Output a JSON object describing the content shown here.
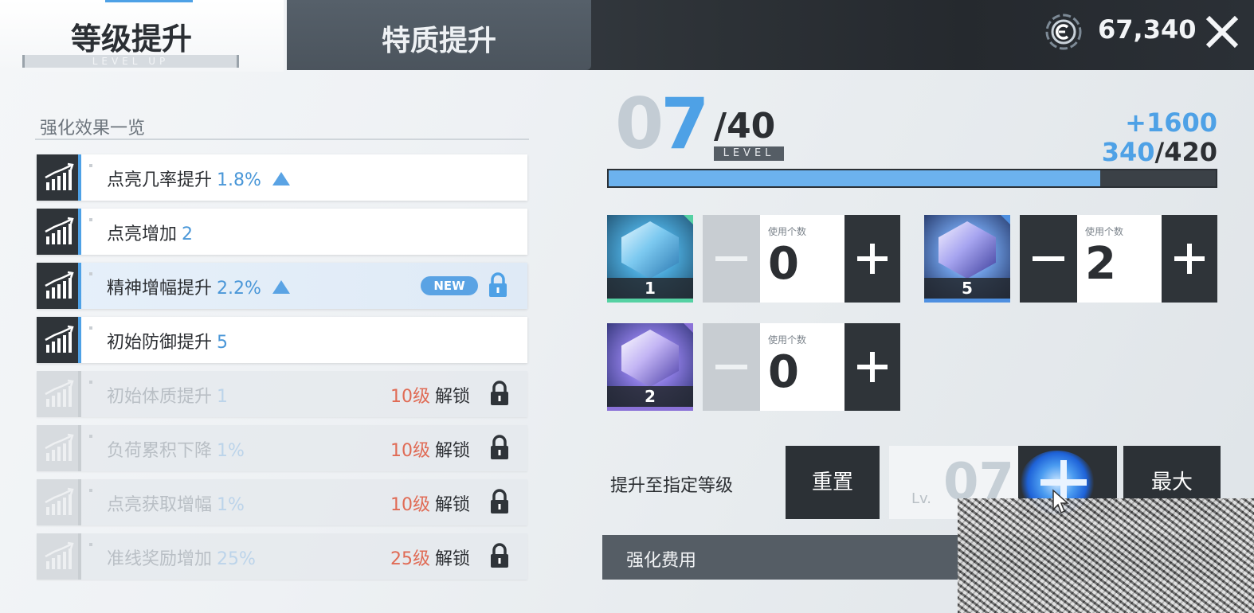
{
  "tabs": {
    "level_up": {
      "label": "等级提升",
      "sub": "LEVEL UP"
    },
    "trait_up": {
      "label": "特质提升"
    }
  },
  "currency": {
    "value": "67,340",
    "icon": "currency-icon"
  },
  "effects": {
    "title": "强化效果一览",
    "rows": [
      {
        "name": "点亮几率提升",
        "value": "1.8%"
      },
      {
        "name": "点亮增加",
        "value": "2"
      },
      {
        "name": "精神增幅提升",
        "value": "2.2%",
        "badge": "NEW"
      },
      {
        "name": "初始防御提升",
        "value": "5"
      },
      {
        "name": "初始体质提升",
        "value": "1",
        "unlock_level": "10级",
        "unlock_text": "解锁"
      },
      {
        "name": "负荷累积下降",
        "value": "1%",
        "unlock_level": "10级",
        "unlock_text": "解锁"
      },
      {
        "name": "点亮获取增幅",
        "value": "1%",
        "unlock_level": "10级",
        "unlock_text": "解锁"
      },
      {
        "name": "准线奖励增加",
        "value": "25%",
        "unlock_level": "25级",
        "unlock_text": "解锁"
      }
    ]
  },
  "level": {
    "digit0": "0",
    "digit1": "7",
    "max": "/40",
    "tag": "LEVEL",
    "exp_gain": "+1600",
    "exp_current": "340",
    "exp_total": "/420",
    "exp_fraction": 0.81
  },
  "items": [
    {
      "count": "1",
      "use_label": "使用个数",
      "use_value": "0"
    },
    {
      "count": "5",
      "use_label": "使用个数",
      "use_value": "2"
    },
    {
      "count": "2",
      "use_label": "使用个数",
      "use_value": "0"
    }
  ],
  "goto": {
    "label": "提升至指定等级",
    "reset": "重置",
    "lv_prefix": "Lv.",
    "lv_value": "07",
    "max": "最大"
  },
  "cost": {
    "label": "强化费用"
  },
  "colors": {
    "accent": "#4ea1e6",
    "unlock_red": "#e06b55",
    "dark": "#2c3136"
  }
}
